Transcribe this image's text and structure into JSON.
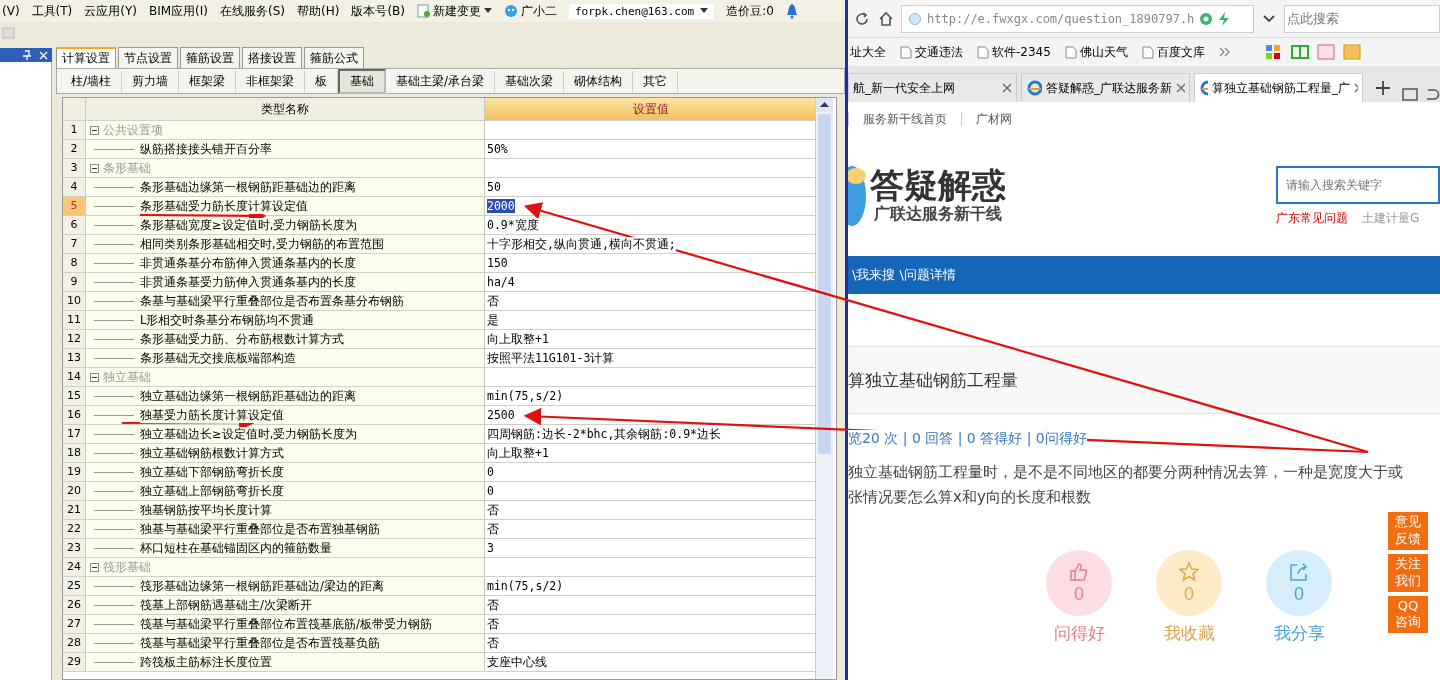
{
  "menu_bar": {
    "items": [
      "(V)",
      "工具(T)",
      "云应用(Y)",
      "BIM应用(I)",
      "在线服务(S)",
      "帮助(H)",
      "版本号(B)"
    ],
    "new_change": "新建变更",
    "assistant": "广小二",
    "account": "forpk.chen@163.com",
    "beans": "造价豆:0"
  },
  "main_tabs": [
    {
      "label": "计算设置",
      "selected": true
    },
    {
      "label": "节点设置",
      "selected": false
    },
    {
      "label": "箍筋设置",
      "selected": false
    },
    {
      "label": "搭接设置",
      "selected": false
    },
    {
      "label": "箍筋公式",
      "selected": false
    }
  ],
  "sub_tabs": [
    {
      "label": "柱/墙柱",
      "selected": false
    },
    {
      "label": "剪力墙",
      "selected": false
    },
    {
      "label": "框架梁",
      "selected": false
    },
    {
      "label": "非框架梁",
      "selected": false
    },
    {
      "label": "板",
      "selected": false
    },
    {
      "label": "基础",
      "selected": true
    },
    {
      "label": "基础主梁/承台梁",
      "selected": false
    },
    {
      "label": "基础次梁",
      "selected": false
    },
    {
      "label": "砌体结构",
      "selected": false
    },
    {
      "label": "其它",
      "selected": false
    }
  ],
  "table": {
    "columns": [
      "类型名称",
      "设置值"
    ],
    "rows": [
      {
        "number": "1",
        "kind": "group",
        "name": "公共设置项",
        "value": "",
        "selected": false,
        "expanded": true
      },
      {
        "number": "2",
        "kind": "item",
        "name": "纵筋搭接接头错开百分率",
        "value": "50%",
        "selected": false
      },
      {
        "number": "3",
        "kind": "group",
        "name": "条形基础",
        "value": "",
        "selected": false,
        "expanded": true
      },
      {
        "number": "4",
        "kind": "item",
        "name": "条形基础边缘第一根钢筋距基础边的距离",
        "value": "50",
        "selected": false
      },
      {
        "number": "5",
        "kind": "item",
        "name": "条形基础受力筋长度计算设定值",
        "value": "2000",
        "selected": true
      },
      {
        "number": "6",
        "kind": "item",
        "name": "条形基础宽度≥设定值时,受力钢筋长度为",
        "value": "0.9*宽度",
        "selected": false
      },
      {
        "number": "7",
        "kind": "item",
        "name": "相同类别条形基础相交时,受力钢筋的布置范围",
        "value": "十字形相交,纵向贯通,横向不贯通;",
        "selected": false
      },
      {
        "number": "8",
        "kind": "item",
        "name": "非贯通条基分布筋伸入贯通条基内的长度",
        "value": "150",
        "selected": false
      },
      {
        "number": "9",
        "kind": "item",
        "name": "非贯通条基受力筋伸入贯通条基内的长度",
        "value": "ha/4",
        "selected": false
      },
      {
        "number": "10",
        "kind": "item",
        "name": "条基与基础梁平行重叠部位是否布置条基分布钢筋",
        "value": "否",
        "selected": false
      },
      {
        "number": "11",
        "kind": "item",
        "name": "L形相交时条基分布钢筋均不贯通",
        "value": "是",
        "selected": false
      },
      {
        "number": "12",
        "kind": "item",
        "name": "条形基础受力筋、分布筋根数计算方式",
        "value": "向上取整+1",
        "selected": false
      },
      {
        "number": "13",
        "kind": "item",
        "name": "条形基础无交接底板端部构造",
        "value": "按照平法11G101-3计算",
        "selected": false
      },
      {
        "number": "14",
        "kind": "group",
        "name": "独立基础",
        "value": "",
        "selected": false,
        "expanded": true
      },
      {
        "number": "15",
        "kind": "item",
        "name": "独立基础边缘第一根钢筋距基础边的距离",
        "value": "min(75,s/2)",
        "selected": false
      },
      {
        "number": "16",
        "kind": "item",
        "name": "独基受力筋长度计算设定值",
        "value": "2500",
        "selected": false
      },
      {
        "number": "17",
        "kind": "item",
        "name": "独立基础边长≥设定值时,受力钢筋长度为",
        "value": "四周钢筋:边长-2*bhc,其余钢筋:0.9*边长",
        "selected": false
      },
      {
        "number": "18",
        "kind": "item",
        "name": "独立基础钢筋根数计算方式",
        "value": "向上取整+1",
        "selected": false
      },
      {
        "number": "19",
        "kind": "item",
        "name": "独立基础下部钢筋弯折长度",
        "value": "0",
        "selected": false
      },
      {
        "number": "20",
        "kind": "item",
        "name": "独立基础上部钢筋弯折长度",
        "value": "0",
        "selected": false
      },
      {
        "number": "21",
        "kind": "item",
        "name": "独基钢筋按平均长度计算",
        "value": "否",
        "selected": false
      },
      {
        "number": "22",
        "kind": "item",
        "name": "独基与基础梁平行重叠部位是否布置独基钢筋",
        "value": "否",
        "selected": false
      },
      {
        "number": "23",
        "kind": "item",
        "name": "杯口短柱在基础锚固区内的箍筋数量",
        "value": "3",
        "selected": false
      },
      {
        "number": "24",
        "kind": "group",
        "name": "筏形基础",
        "value": "",
        "selected": false,
        "expanded": true
      },
      {
        "number": "25",
        "kind": "item",
        "name": "筏形基础边缘第一根钢筋距基础边/梁边的距离",
        "value": "min(75,s/2)",
        "selected": false
      },
      {
        "number": "26",
        "kind": "item",
        "name": "筏基上部钢筋遇基础主/次梁断开",
        "value": "否",
        "selected": false
      },
      {
        "number": "27",
        "kind": "item",
        "name": "筏基与基础梁平行重叠部位布置筏基底筋/板带受力钢筋",
        "value": "否",
        "selected": false
      },
      {
        "number": "28",
        "kind": "item",
        "name": "筏基与基础梁平行重叠部位是否布置筏基负筋",
        "value": "否",
        "selected": false
      },
      {
        "number": "29",
        "kind": "item",
        "name": "跨筏板主筋标注长度位置",
        "value": "支座中心线",
        "selected": false
      }
    ]
  },
  "browser": {
    "url": "http://e.fwxgx.com/question_1890797.h",
    "search_placeholder": "点此搜索",
    "bookmarks": [
      "址大全",
      "交通违法",
      "软件-2345",
      "佛山天气",
      "百度文库"
    ],
    "tabs": [
      {
        "label": "航_新一代安全上网",
        "selected": false
      },
      {
        "label": "答疑解惑_广联达服务新",
        "selected": false
      },
      {
        "label": "算独立基础钢筋工程量_广",
        "selected": true
      }
    ],
    "site_links": [
      "服务新干线首页",
      "广材网"
    ],
    "logo_title": "答疑解惑",
    "logo_subtitle": "广联达服务新干线",
    "site_search_placeholder": "请输入搜索关键字",
    "hot_links": [
      {
        "label": "广东常见问题",
        "highlighted": true
      },
      {
        "label": "土建计量G",
        "highlighted": false
      }
    ],
    "breadcrumb": "\\我来搜 \\问题详情",
    "question_title": "算独立基础钢筋工程量",
    "stats": "览20 次 | 0 回答 | 0 答得好 | 0问得好",
    "body_lines": [
      "独立基础钢筋工程量时，是不是不同地区的都要分两种情况去算，一种是宽度大于或",
      "张情况要怎么算x和y向的长度和根数"
    ],
    "actions": [
      {
        "kind": "thumb",
        "count": "0",
        "label": "问得好",
        "color": "#e57e8a"
      },
      {
        "kind": "star",
        "count": "0",
        "label": "我收藏",
        "color": "#e0a64a"
      },
      {
        "kind": "share",
        "count": "0",
        "label": "我分享",
        "color": "#4aa3d8"
      }
    ],
    "float_buttons": [
      "意见反馈",
      "关注我们",
      "QQ咨询"
    ]
  }
}
